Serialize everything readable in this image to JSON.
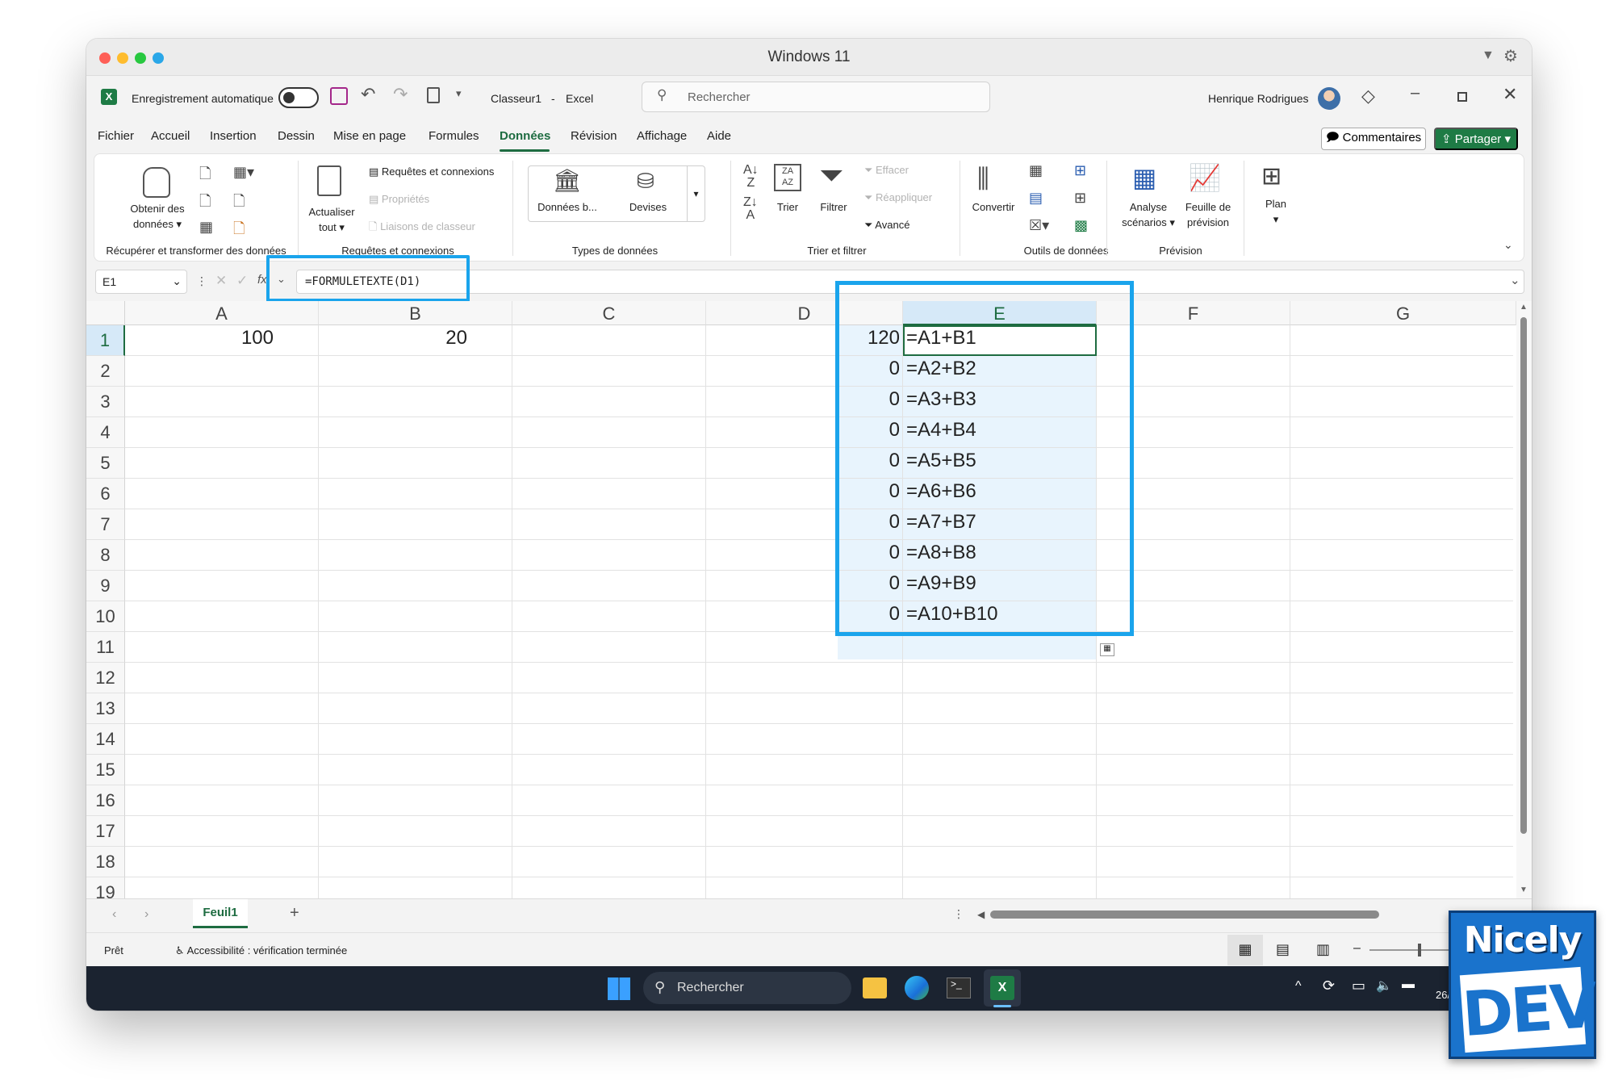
{
  "mac": {
    "title": "Windows 11"
  },
  "app": {
    "autosave_label": "Enregistrement automatique",
    "doc_name": "Classeur1",
    "app_sep": "-",
    "app_name": "Excel",
    "search_placeholder": "Rechercher",
    "user_name": "Henrique Rodrigues"
  },
  "tabs": [
    {
      "label": "Fichier"
    },
    {
      "label": "Accueil"
    },
    {
      "label": "Insertion"
    },
    {
      "label": "Dessin"
    },
    {
      "label": "Mise en page"
    },
    {
      "label": "Formules"
    },
    {
      "label": "Données",
      "active": true
    },
    {
      "label": "Révision"
    },
    {
      "label": "Affichage"
    },
    {
      "label": "Aide"
    }
  ],
  "top_actions": {
    "comments": "Commentaires",
    "share": "Partager"
  },
  "ribbon": {
    "get_data": [
      "Obtenir des",
      "données"
    ],
    "refresh": [
      "Actualiser",
      "tout"
    ],
    "queries": "Requêtes et connexions",
    "properties": "Propriétés",
    "links": "Liaisons de classeur",
    "stocks": "Données b...",
    "currencies": "Devises",
    "sort": "Trier",
    "filter": "Filtrer",
    "clear": "Effacer",
    "reapply": "Réappliquer",
    "advanced": "Avancé",
    "convert": "Convertir",
    "whatif": [
      "Analyse",
      "scénarios"
    ],
    "forecast_sheet": [
      "Feuille de",
      "prévision"
    ],
    "outline": "Plan",
    "groups": {
      "get_transform": "Récupérer et transformer des données",
      "queries": "Requêtes et connexions",
      "data_types": "Types de données",
      "sort_filter": "Trier et filtrer",
      "data_tools": "Outils de données",
      "forecast": "Prévision"
    }
  },
  "formula_bar": {
    "name_box": "E1",
    "fx": "fx",
    "formula": "=FORMULETEXTE(D1)"
  },
  "columns": [
    "A",
    "B",
    "C",
    "D",
    "E",
    "F",
    "G"
  ],
  "rows": [
    "1",
    "2",
    "3",
    "4",
    "5",
    "6",
    "7",
    "8",
    "9",
    "10",
    "11",
    "12",
    "13",
    "14",
    "15",
    "16",
    "17",
    "18",
    "19"
  ],
  "cells": {
    "A1": "100",
    "B1": "20",
    "D": [
      "120",
      "0",
      "0",
      "0",
      "0",
      "0",
      "0",
      "0",
      "0",
      "0"
    ],
    "E": [
      "=A1+B1",
      "=A2+B2",
      "=A3+B3",
      "=A4+B4",
      "=A5+B5",
      "=A6+B6",
      "=A7+B7",
      "=A8+B8",
      "=A9+B9",
      "=A10+B10"
    ]
  },
  "sheet": {
    "name": "Feuil1",
    "add": "+"
  },
  "status": {
    "ready": "Prêt",
    "accessibility": "Accessibilité : vérification terminée"
  },
  "taskbar": {
    "search": "Rechercher",
    "date": "26/"
  },
  "badge": {
    "line1": "Nicely",
    "line2": "DEV"
  },
  "colors": {
    "excel_green": "#1e6c41",
    "highlight": "#1aa4ec",
    "selection_fill": "#e8f4fd"
  }
}
